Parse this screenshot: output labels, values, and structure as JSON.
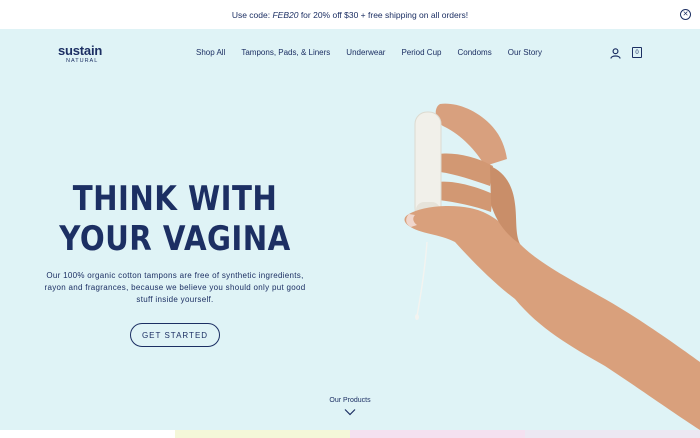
{
  "promo": {
    "text_before": "Use code: ",
    "code": "FEB20",
    "text_after": " for 20% off $30 + free shipping on all orders!",
    "close_icon": "close-icon"
  },
  "header": {
    "logo_main": "sustain",
    "logo_sub": "NATURAL",
    "nav": [
      "Shop All",
      "Tampons, Pads, & Liners",
      "Underwear",
      "Period Cup",
      "Condoms",
      "Our Story"
    ],
    "cart_count": "0",
    "icons": [
      "user-icon",
      "cart-icon"
    ]
  },
  "hero": {
    "headline_line1": "THINK WITH",
    "headline_line2": "YOUR VAGINA",
    "subtext": "Our 100% organic cotton tampons are free of synthetic ingredients, rayon and fragrances, because we believe you should only put good stuff inside yourself.",
    "cta_label": "GET STARTED",
    "background_color": "#dff3f6",
    "text_color": "#1c2f63"
  },
  "products": {
    "label": "Our Products",
    "icon": "chevron-down-icon"
  },
  "strip_colors": [
    "#ffffff",
    "#f4f7d9",
    "#f4e1f0",
    "#ece8f2"
  ]
}
